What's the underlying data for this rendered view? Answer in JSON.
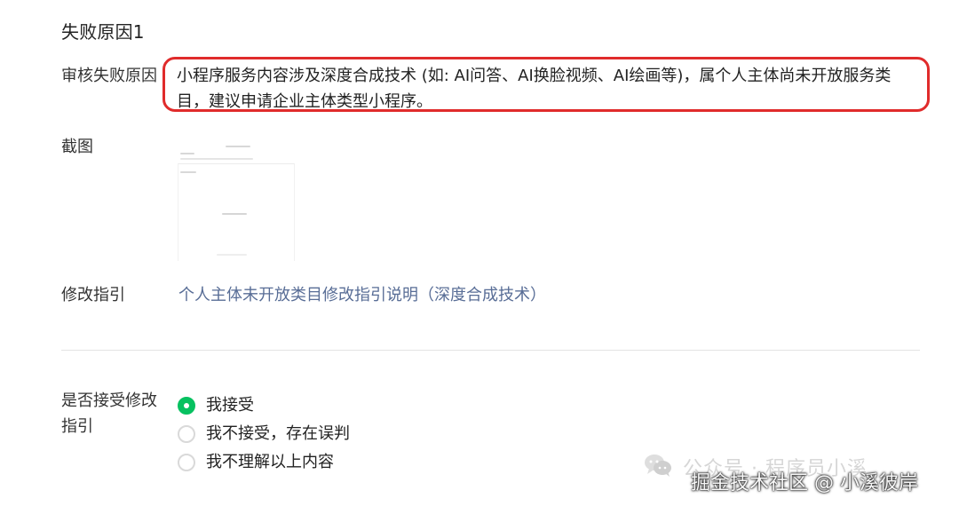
{
  "section": {
    "title": "失败原因1"
  },
  "review": {
    "reason_label": "审核失败原因",
    "reason_text": "小程序服务内容涉及深度合成技术 (如: AI问答、AI换脸视频、AI绘画等)，属个人主体尚未开放服务类目，建议申请企业主体类型小程序。",
    "screenshot_label": "截图",
    "guide_label": "修改指引",
    "guide_link": "个人主体未开放类目修改指引说明（深度合成技术）"
  },
  "acceptance": {
    "label": "是否接受修改指引",
    "options": [
      {
        "label": "我接受",
        "selected": true
      },
      {
        "label": "我不接受，存在误判",
        "selected": false
      },
      {
        "label": "我不理解以上内容",
        "selected": false
      }
    ]
  },
  "watermark": {
    "line1": "公众号 · 程序员小溪",
    "line2": "掘金技术社区 @ 小溪彼岸",
    "icon": "wechat-icon"
  },
  "colors": {
    "alert_border": "#e02b2b",
    "link": "#586d96",
    "selected_radio": "#07c160"
  }
}
